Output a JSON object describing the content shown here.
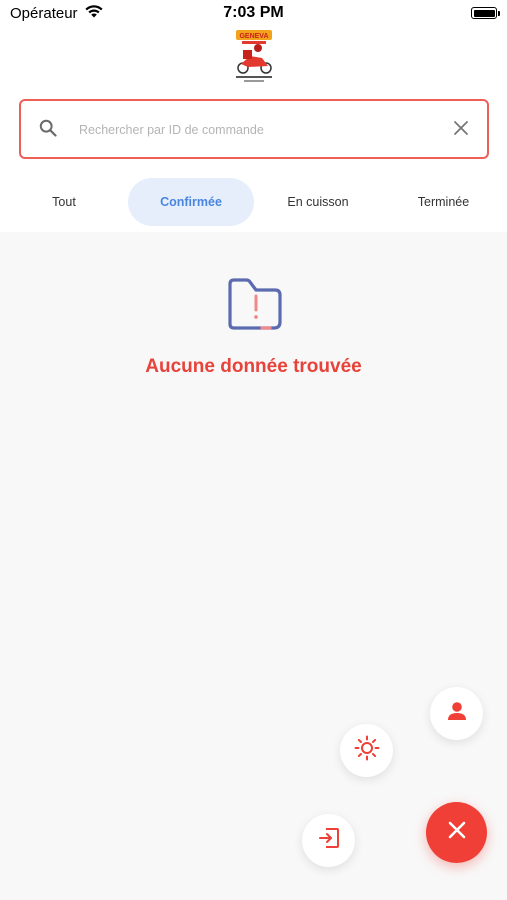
{
  "status_bar": {
    "carrier": "Opérateur",
    "time": "7:03 PM"
  },
  "header": {
    "logo_text": "GENEVA"
  },
  "search": {
    "placeholder": "Rechercher par ID de commande",
    "value": ""
  },
  "tabs": [
    {
      "label": "Tout",
      "active": false
    },
    {
      "label": "Confirmée",
      "active": true
    },
    {
      "label": "En cuisson",
      "active": false
    },
    {
      "label": "Terminée",
      "active": false
    }
  ],
  "empty_state": {
    "message": "Aucune donnée trouvée",
    "icon": "folder-alert-icon"
  },
  "fab_menu": {
    "items": [
      {
        "icon": "user-icon"
      },
      {
        "icon": "sun-icon"
      },
      {
        "icon": "logout-icon"
      }
    ],
    "main_icon": "close-icon"
  },
  "colors": {
    "primary": "#ef3f36",
    "search_border": "#ee5f58",
    "active_tab_bg": "#e6eefb",
    "active_tab_text": "#4a86e0",
    "empty_icon_blue": "#5c6bb0"
  }
}
